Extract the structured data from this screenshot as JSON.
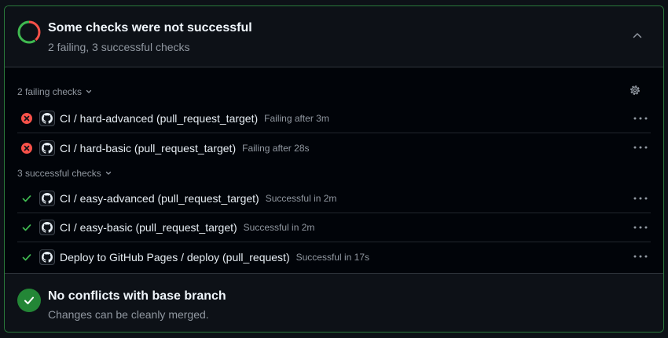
{
  "summary": {
    "title": "Some checks were not successful",
    "subtitle": "2 failing, 3 successful checks",
    "failing_count": 2,
    "successful_count": 3,
    "donut_icon": "partial-status-donut-icon",
    "collapse_icon": "chevron-up-icon"
  },
  "failing_group": {
    "label": "2 failing checks",
    "settings_icon": "gear-icon",
    "checks": [
      {
        "name": "CI / hard-advanced (pull_request_target)",
        "status": "Failing after 3m"
      },
      {
        "name": "CI / hard-basic (pull_request_target)",
        "status": "Failing after 28s"
      }
    ]
  },
  "successful_group": {
    "label": "3 successful checks",
    "checks": [
      {
        "name": "CI / easy-advanced (pull_request_target)",
        "status": "Successful in 2m"
      },
      {
        "name": "CI / easy-basic (pull_request_target)",
        "status": "Successful in 2m"
      },
      {
        "name": "Deploy to GitHub Pages / deploy (pull_request)",
        "status": "Successful in 17s"
      }
    ]
  },
  "merge": {
    "title": "No conflicts with base branch",
    "subtitle": "Changes can be cleanly merged.",
    "icon": "check-circle-icon"
  },
  "colors": {
    "fail": "#f85149",
    "success": "#3fb950",
    "success_bg": "#238636",
    "border_green": "#2a7a3b",
    "muted": "#9198a1"
  }
}
